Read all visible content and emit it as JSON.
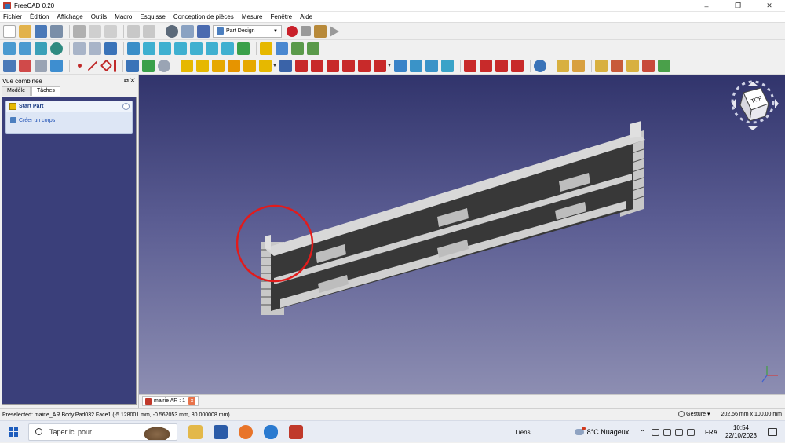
{
  "window": {
    "title": "FreeCAD 0.20",
    "min": "–",
    "max": "❐",
    "close": "✕"
  },
  "menu": [
    "Fichier",
    "Édition",
    "Affichage",
    "Outils",
    "Macro",
    "Esquisse",
    "Conception de pièces",
    "Mesure",
    "Fenêtre",
    "Aide"
  ],
  "toolbar": {
    "workbench": "Part Design"
  },
  "panel": {
    "title": "Vue combinée",
    "header_buttons": "⧉ ✕",
    "tabs": [
      "Modèle",
      "Tâches"
    ],
    "task_title": "Start Part",
    "task_collapse": "⌃",
    "task_item": "Créer un corps"
  },
  "viewport": {
    "navcube_face": "TOP"
  },
  "document_tab": {
    "label": "mairie AR : 1",
    "close": "x"
  },
  "status": {
    "preselected": "Preselected: mairie_AR.Body.Pad032.Face1 (-5.128001 mm, -0.562053 mm, 80.000008 mm)",
    "nav_style": "Gesture",
    "nav_arrow": "▾",
    "dimensions": "202.56 mm x 100.00 mm"
  },
  "taskbar": {
    "search_placeholder": "Taper ici pour",
    "links": "Liens",
    "weather": "8°C Nuageux",
    "caret": "⌃",
    "language": "FRA",
    "time": "10:54",
    "date": "22/10/2023"
  },
  "colors": {
    "viewport_top": "#31346c",
    "viewport_bottom": "#8d8eb2",
    "highlight_circle": "#e21b1b",
    "task_panel_bg": "#3a3f7a"
  }
}
